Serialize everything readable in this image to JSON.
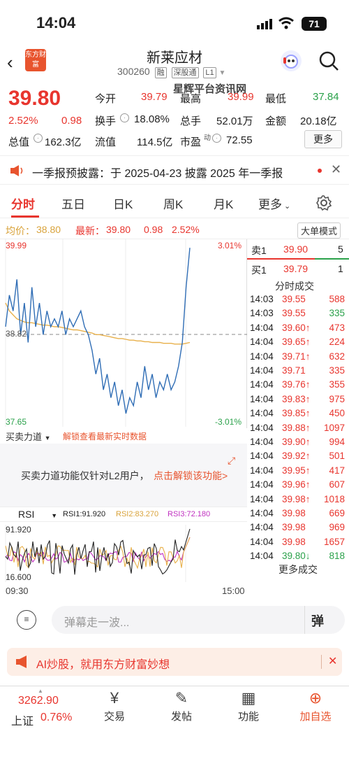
{
  "status": {
    "time": "14:04",
    "battery": "71"
  },
  "header": {
    "title": "新莱应材",
    "code": "300260",
    "tags": [
      "融",
      "深股通",
      "L1"
    ],
    "logo_text": "东方财富",
    "watermark": "星辉平台资讯网"
  },
  "quote": {
    "price": "39.80",
    "change_pct": "2.52%",
    "change": "0.98",
    "open_label": "今开",
    "open": "39.79",
    "high_label": "最高",
    "high": "39.99",
    "low_label": "最低",
    "low": "37.84",
    "turnover_label": "换手",
    "turnover": "18.08%",
    "volume_label": "总手",
    "volume": "52.01万",
    "amount_label": "金额",
    "amount": "20.18亿",
    "mktcap_label": "总值",
    "mktcap": "162.3亿",
    "float_label": "流值",
    "float": "114.5亿",
    "pe_label": "市盈",
    "pe_sup": "动",
    "pe": "72.55",
    "more": "更多"
  },
  "notice": {
    "text": "一季报预披露：于 2025-04-23 披露 2025 年一季报"
  },
  "tabs": [
    "分时",
    "五日",
    "日K",
    "周K",
    "月K",
    "更多"
  ],
  "infobar": {
    "avg_label": "均价：",
    "avg": "38.80",
    "latest_label": "最新：",
    "latest": "39.80",
    "change": "0.98",
    "pct": "2.52%",
    "mode": "大单模式"
  },
  "axis": {
    "top": "39.99",
    "bottom": "37.65",
    "mid": "38.82",
    "top_pct": "3.01%",
    "bottom_pct": "-3.01%"
  },
  "orderbook": {
    "sell_label": "卖1",
    "sell_price": "39.90",
    "sell_vol": "5",
    "buy_label": "买1",
    "buy_price": "39.79",
    "buy_vol": "1",
    "title": "分时成交",
    "trades": [
      {
        "t": "14:03",
        "p": "39.55",
        "v": "588",
        "dir": "",
        "c": "#e8352e"
      },
      {
        "t": "14:03",
        "p": "39.55",
        "v": "335",
        "dir": "",
        "c": "#2aa14a"
      },
      {
        "t": "14:04",
        "p": "39.60",
        "v": "473",
        "dir": "↑",
        "c": "#e8352e"
      },
      {
        "t": "14:04",
        "p": "39.65",
        "v": "224",
        "dir": "↑",
        "c": "#e8352e"
      },
      {
        "t": "14:04",
        "p": "39.71",
        "v": "632",
        "dir": "↑",
        "c": "#e8352e"
      },
      {
        "t": "14:04",
        "p": "39.71",
        "v": "335",
        "dir": "",
        "c": "#e8352e"
      },
      {
        "t": "14:04",
        "p": "39.76",
        "v": "355",
        "dir": "↑",
        "c": "#e8352e"
      },
      {
        "t": "14:04",
        "p": "39.83",
        "v": "975",
        "dir": "↑",
        "c": "#e8352e"
      },
      {
        "t": "14:04",
        "p": "39.85",
        "v": "450",
        "dir": "↑",
        "c": "#e8352e"
      },
      {
        "t": "14:04",
        "p": "39.88",
        "v": "1097",
        "dir": "↑",
        "c": "#e8352e"
      },
      {
        "t": "14:04",
        "p": "39.90",
        "v": "994",
        "dir": "↑",
        "c": "#e8352e"
      },
      {
        "t": "14:04",
        "p": "39.92",
        "v": "501",
        "dir": "↑",
        "c": "#e8352e"
      },
      {
        "t": "14:04",
        "p": "39.95",
        "v": "417",
        "dir": "↑",
        "c": "#e8352e"
      },
      {
        "t": "14:04",
        "p": "39.96",
        "v": "607",
        "dir": "↑",
        "c": "#e8352e"
      },
      {
        "t": "14:04",
        "p": "39.98",
        "v": "1018",
        "dir": "↑",
        "c": "#e8352e"
      },
      {
        "t": "14:04",
        "p": "39.98",
        "v": "669",
        "dir": "",
        "c": "#e8352e"
      },
      {
        "t": "14:04",
        "p": "39.98",
        "v": "969",
        "dir": "",
        "c": "#e8352e"
      },
      {
        "t": "14:04",
        "p": "39.98",
        "v": "1657",
        "dir": "",
        "c": "#e8352e"
      },
      {
        "t": "14:04",
        "p": "39.80",
        "v": "818",
        "dir": "↓",
        "c": "#2aa14a"
      }
    ],
    "more_trades": "更多成交"
  },
  "l2": {
    "dropdown": "买卖力道",
    "unlock_link": "解锁查看最新实时数据",
    "message": "买卖力道功能仅针对L2用户，",
    "message_link": "点击解锁该功能>"
  },
  "rsi": {
    "label": "RSI",
    "rsi1": "RSI1:91.920",
    "rsi2": "RSI2:83.270",
    "rsi3": "RSI3:72.180",
    "top": "91.920",
    "bottom": "16.600"
  },
  "xaxis": {
    "start": "09:30",
    "end": "15:00"
  },
  "danmu": {
    "placeholder": "弹幕走一波...",
    "btn": "弹"
  },
  "ai_banner": {
    "text": "AI炒股，就用东方财富妙想"
  },
  "bottom": {
    "index_value": "3262.90",
    "index_name": "上证",
    "index_pct": "0.76%",
    "nav": [
      {
        "label": "交易"
      },
      {
        "label": "发帖"
      },
      {
        "label": "功能"
      },
      {
        "label": "加自选"
      }
    ]
  },
  "colors": {
    "up": "#e8352e",
    "down": "#2aa14a",
    "price_line": "#2f6db5",
    "avg_line": "#e8b04a"
  },
  "chart_data": {
    "type": "line",
    "title": "",
    "xlabel": "",
    "ylabel": "",
    "x": [
      "09:30",
      "15:00"
    ],
    "ylim": [
      37.65,
      39.99
    ],
    "series": [
      {
        "values": [
          38.9,
          39.3,
          39.1,
          39.5,
          38.8,
          39.2,
          38.7,
          39.4,
          38.9,
          39.2,
          38.8,
          39.1,
          38.9,
          39.0,
          38.9,
          39.1,
          38.8,
          39.0,
          38.9,
          39.0,
          39.1,
          38.9,
          38.8,
          38.6,
          38.3,
          38.5,
          38.1,
          38.3,
          38.0,
          38.2,
          37.9,
          38.1,
          37.8,
          38.0,
          37.9,
          38.2,
          38.0,
          38.4,
          38.1,
          38.3,
          38.0,
          38.2,
          38.1,
          38.3,
          38.1,
          38.2,
          38.4,
          38.7,
          39.4,
          39.9
        ]
      },
      {
        "values": [
          39.2,
          39.1,
          39.05,
          39.0,
          38.98,
          38.96,
          38.95,
          38.95,
          38.94,
          38.93,
          38.92,
          38.92,
          38.91,
          38.9,
          38.9,
          38.89,
          38.88,
          38.87,
          38.86,
          38.86,
          38.85,
          38.84,
          38.83,
          38.82,
          38.8,
          38.8,
          38.79,
          38.78,
          38.77,
          38.76,
          38.75,
          38.75,
          38.74,
          38.73,
          38.73,
          38.72,
          38.72,
          38.71,
          38.71,
          38.7,
          38.7,
          38.7,
          38.69,
          38.69,
          38.69,
          38.68,
          38.68,
          38.68,
          38.69,
          38.7
        ]
      }
    ]
  }
}
